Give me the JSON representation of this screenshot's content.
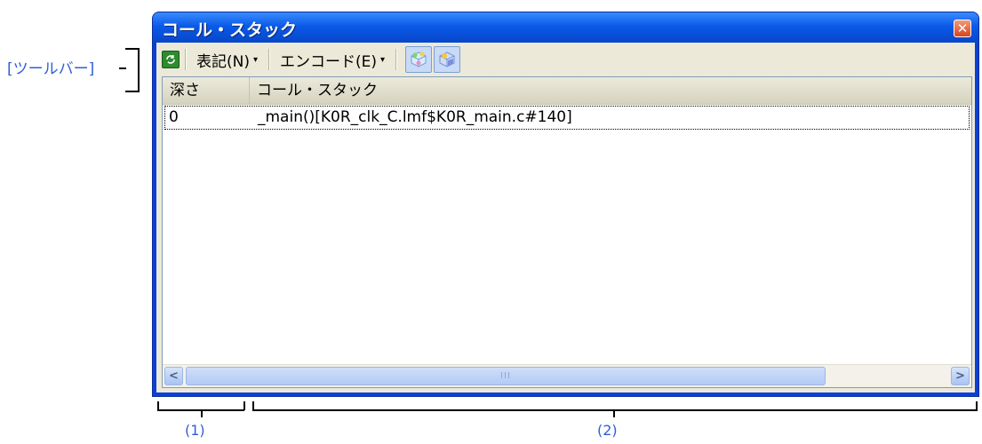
{
  "annotations": {
    "toolbar_label": "[ツールバー]",
    "marker_1": "(1)",
    "marker_2": "(2)"
  },
  "window": {
    "title": "コール・スタック",
    "close_glyph": "✕"
  },
  "toolbar": {
    "refresh_icon": "refresh-icon",
    "notation_label": "表記(N)",
    "encode_label": "エンコード(E)",
    "dropdown_glyph": "▾"
  },
  "table": {
    "columns": [
      "深さ",
      "コール・スタック"
    ],
    "rows": [
      {
        "depth": "0",
        "call_stack": "_main()[K0R_clk_C.lmf$K0R_main.c#140]"
      }
    ]
  },
  "scrollbar": {
    "left_glyph": "<",
    "right_glyph": ">",
    "thumb_grip": "III"
  },
  "colors": {
    "title_bar": "#0a5ae8",
    "annotation_text": "#2f5fd6",
    "client_bg": "#ece9d8"
  }
}
